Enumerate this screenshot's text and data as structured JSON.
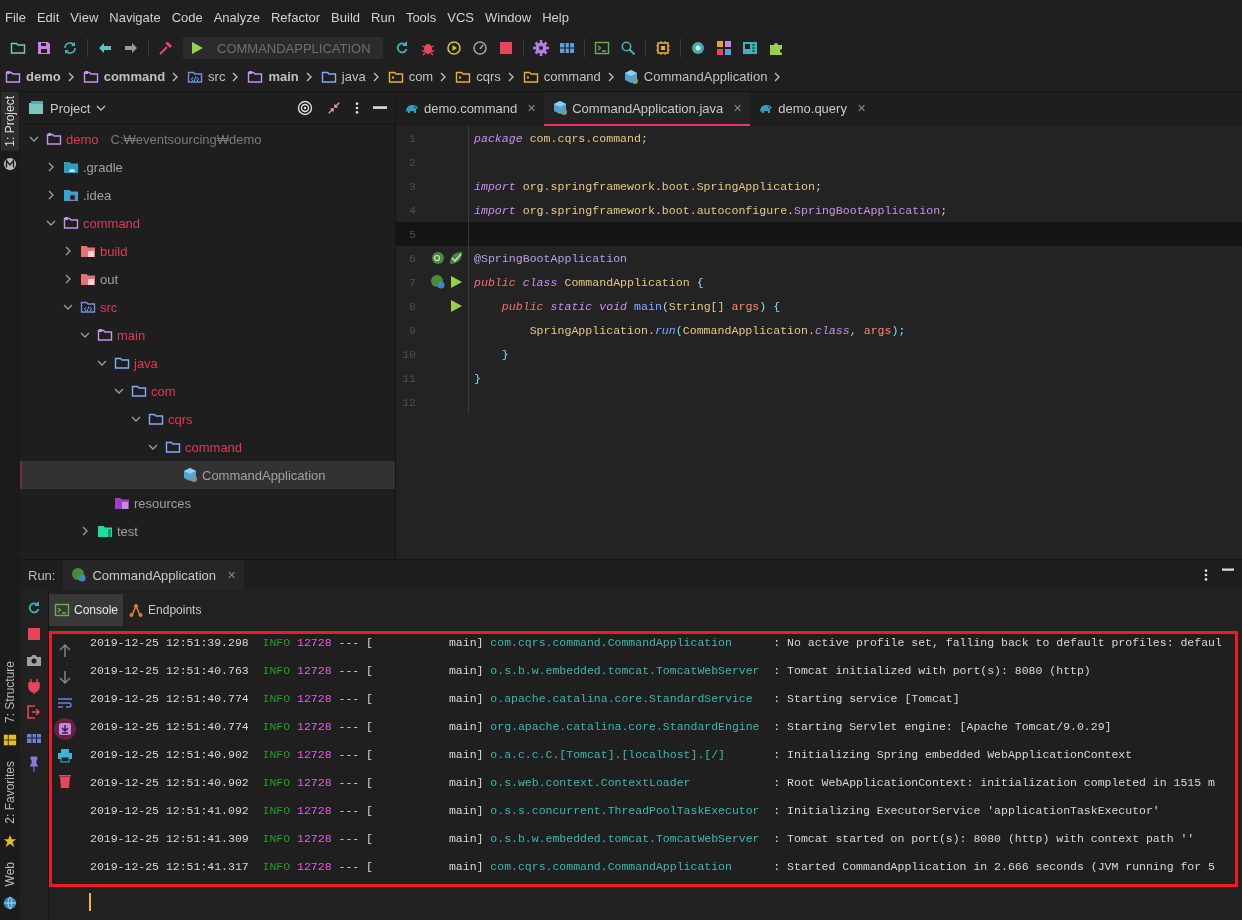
{
  "menu": [
    "File",
    "Edit",
    "View",
    "Navigate",
    "Code",
    "Analyze",
    "Refactor",
    "Build",
    "Run",
    "Tools",
    "VCS",
    "Window",
    "Help"
  ],
  "toolbar": [
    {
      "kind": "open"
    },
    {
      "kind": "save"
    },
    {
      "kind": "sync"
    },
    {
      "kind": "sep"
    },
    {
      "kind": "back"
    },
    {
      "kind": "forward"
    },
    {
      "kind": "sep"
    },
    {
      "kind": "build"
    },
    {
      "kind": "run-config",
      "label": "COMMANDAPPLICATION"
    },
    {
      "kind": "rerun"
    },
    {
      "kind": "debug"
    },
    {
      "kind": "coverage"
    },
    {
      "kind": "profile"
    },
    {
      "kind": "stop"
    },
    {
      "kind": "sep"
    },
    {
      "kind": "gear"
    },
    {
      "kind": "grid"
    },
    {
      "kind": "sep"
    },
    {
      "kind": "terminal"
    },
    {
      "kind": "search"
    },
    {
      "kind": "sep"
    },
    {
      "kind": "chip"
    },
    {
      "kind": "sep"
    },
    {
      "kind": "dot"
    },
    {
      "kind": "squares"
    },
    {
      "kind": "panel"
    },
    {
      "kind": "puzzle"
    }
  ],
  "breadcrumbs": [
    {
      "label": "demo",
      "kind": "module"
    },
    {
      "label": "command",
      "kind": "module"
    },
    {
      "label": "src",
      "kind": "source"
    },
    {
      "label": "main",
      "kind": "module"
    },
    {
      "label": "java",
      "kind": "folder"
    },
    {
      "label": "com",
      "kind": "package"
    },
    {
      "label": "cqrs",
      "kind": "package"
    },
    {
      "label": "command",
      "kind": "package"
    },
    {
      "label": "CommandApplication",
      "kind": "class"
    }
  ],
  "stripe": {
    "top": [
      {
        "label": "1: Project",
        "selected": true
      }
    ],
    "bottom": [
      {
        "label": "7: Structure",
        "selected": false
      },
      {
        "label": "2: Favorites",
        "selected": false
      },
      {
        "label": "Web",
        "selected": false
      }
    ]
  },
  "project": {
    "title": "Project",
    "tree": [
      {
        "name": "demo",
        "hint": "C:₩eventsourcing₩demo",
        "kind": "module",
        "color": "#e8335c",
        "expanded": true,
        "selected": false,
        "children": [
          {
            "name": ".gradle",
            "kind": "gradle",
            "color": "#a0a0a0",
            "expanded": false,
            "selected": false
          },
          {
            "name": ".idea",
            "kind": "idea",
            "color": "#a0a0a0",
            "expanded": false,
            "selected": false
          },
          {
            "name": "command",
            "kind": "module",
            "color": "#e8335c",
            "expanded": true,
            "selected": false,
            "children": [
              {
                "name": "build",
                "kind": "excluded",
                "color": "#e8335c",
                "expanded": false,
                "selected": false
              },
              {
                "name": "out",
                "kind": "excluded",
                "color": "#a0a0a0",
                "expanded": false,
                "selected": false
              },
              {
                "name": "src",
                "kind": "source",
                "color": "#e8335c",
                "expanded": true,
                "selected": false,
                "children": [
                  {
                    "name": "main",
                    "kind": "module",
                    "color": "#e8335c",
                    "expanded": true,
                    "selected": false,
                    "children": [
                      {
                        "name": "java",
                        "kind": "folder",
                        "color": "#e8335c",
                        "expanded": true,
                        "selected": false,
                        "children": [
                          {
                            "name": "com",
                            "kind": "folder",
                            "color": "#e8335c",
                            "expanded": true,
                            "selected": false,
                            "children": [
                              {
                                "name": "cqrs",
                                "kind": "folder",
                                "color": "#e8335c",
                                "expanded": true,
                                "selected": false,
                                "children": [
                                  {
                                    "name": "command",
                                    "kind": "folder",
                                    "color": "#e8335c",
                                    "expanded": true,
                                    "selected": false,
                                    "children": [
                                      {
                                        "name": "CommandApplication",
                                        "kind": "class",
                                        "color": "#a0a0a0",
                                        "selected": true
                                      }
                                    ]
                                  }
                                ]
                              }
                            ]
                          }
                        ]
                      },
                      {
                        "name": "resources",
                        "kind": "resources",
                        "color": "#a0a0a0",
                        "selected": false
                      }
                    ]
                  },
                  {
                    "name": "test",
                    "kind": "test",
                    "color": "#a0a0a0",
                    "expanded": false,
                    "selected": false
                  }
                ]
              }
            ]
          }
        ]
      }
    ]
  },
  "editor": {
    "tabs": [
      {
        "label": "demo.command",
        "kind": "gradle",
        "close": "✕",
        "selected": false
      },
      {
        "label": "CommandApplication.java",
        "kind": "class",
        "close": "✕",
        "selected": true
      },
      {
        "label": "demo.query",
        "kind": "gradle",
        "close": "✕",
        "selected": false
      }
    ],
    "lines": [
      {
        "number": "1",
        "current": false,
        "tokens": [
          {
            "kind": "kw",
            "t": "package"
          },
          {
            "kind": "ident",
            "t": " com.cqrs.command;"
          }
        ]
      },
      {
        "number": "2",
        "current": false
      },
      {
        "number": "3",
        "current": false,
        "tokens": [
          {
            "kind": "kw",
            "t": "import"
          },
          {
            "kind": "ident",
            "t": " org.springframework.boot.SpringApplication;"
          }
        ]
      },
      {
        "number": "4",
        "current": false,
        "tokens": [
          {
            "kind": "kw",
            "t": "import"
          },
          {
            "kind": "ident",
            "t": " org.springframework.boot.autoconfigure."
          },
          {
            "kind": "type",
            "t": "SpringBootApplication"
          },
          {
            "kind": "ident",
            "t": ";"
          }
        ]
      },
      {
        "number": "5",
        "current": true
      },
      {
        "number": "6",
        "current": false,
        "gutter": [
          {
            "kind": "bean-find"
          },
          {
            "kind": "bean-check"
          }
        ],
        "tokens": [
          {
            "kind": "annot",
            "t": "@SpringBootApplication"
          }
        ]
      },
      {
        "number": "7",
        "current": false,
        "gutter": [
          {
            "kind": "bean-run"
          },
          {
            "kind": "run"
          }
        ],
        "tokens": [
          {
            "kind": "mod",
            "t": "public"
          },
          {
            "kind": "kw",
            "t": " class"
          },
          {
            "kind": "ident",
            "t": " CommandApplication"
          },
          {
            "kind": "punct",
            "t": " {"
          }
        ]
      },
      {
        "number": "8",
        "current": false,
        "gutter": [
          {
            "kind": "run"
          }
        ],
        "tokens": [
          {
            "kind": "mod",
            "t": "    public"
          },
          {
            "kind": "kw",
            "t": " static void"
          },
          {
            "kind": "method",
            "t": " main"
          },
          {
            "kind": "punct",
            "t": "("
          },
          {
            "kind": "ident",
            "t": "String[]"
          },
          {
            "kind": "param",
            "t": " args"
          },
          {
            "kind": "punct",
            "t": ") {"
          }
        ]
      },
      {
        "number": "9",
        "current": false,
        "tokens": [
          {
            "kind": "ident",
            "t": "        SpringApplication."
          },
          {
            "kind": "call",
            "t": "run"
          },
          {
            "kind": "punct",
            "t": "("
          },
          {
            "kind": "ident",
            "t": "CommandApplication."
          },
          {
            "kind": "kw",
            "t": "class"
          },
          {
            "kind": "punct",
            "t": ", "
          },
          {
            "kind": "param",
            "t": "args"
          },
          {
            "kind": "punct",
            "t": ");"
          }
        ]
      },
      {
        "number": "10",
        "current": false,
        "tokens": [
          {
            "kind": "punct",
            "t": "    }"
          }
        ]
      },
      {
        "number": "11",
        "current": false,
        "tokens": [
          {
            "kind": "punct",
            "t": "}"
          }
        ]
      },
      {
        "number": "12",
        "current": false
      }
    ]
  },
  "run": {
    "label": "Run:",
    "tab": "CommandApplication",
    "close": "✕",
    "tools": [
      {
        "kind": "rerun"
      },
      {
        "kind": "stop"
      },
      {
        "kind": "camera"
      },
      {
        "kind": "plug"
      },
      {
        "kind": "exit"
      },
      {
        "kind": "layout"
      },
      {
        "kind": "pin"
      }
    ],
    "console_tabs": [
      {
        "label": "Console",
        "kind": "terminal",
        "selected": true
      },
      {
        "label": "Endpoints",
        "kind": "endpoints",
        "selected": false
      }
    ],
    "gutter": [
      {
        "kind": "up",
        "selected": false
      },
      {
        "kind": "down",
        "selected": false
      },
      {
        "kind": "wrap",
        "selected": false
      },
      {
        "kind": "scroll-end",
        "selected": true
      },
      {
        "kind": "print",
        "selected": false
      },
      {
        "kind": "trash",
        "selected": false
      }
    ],
    "log": [
      {
        "time": "2019-12-25 12:51:39.298",
        "level": "INFO",
        "pid": "12728",
        "sep": "---",
        "thread": "[           main]",
        "logger": "com.cqrs.command.CommandApplication",
        "message": ": No active profile set, falling back to default profiles: defaul"
      },
      {
        "time": "2019-12-25 12:51:40.763",
        "level": "INFO",
        "pid": "12728",
        "sep": "---",
        "thread": "[           main]",
        "logger": "o.s.b.w.embedded.tomcat.TomcatWebServer",
        "message": ": Tomcat initialized with port(s): 8080 (http)"
      },
      {
        "time": "2019-12-25 12:51:40.774",
        "level": "INFO",
        "pid": "12728",
        "sep": "---",
        "thread": "[           main]",
        "logger": "o.apache.catalina.core.StandardService",
        "message": ": Starting service [Tomcat]"
      },
      {
        "time": "2019-12-25 12:51:40.774",
        "level": "INFO",
        "pid": "12728",
        "sep": "---",
        "thread": "[           main]",
        "logger": "org.apache.catalina.core.StandardEngine",
        "message": ": Starting Servlet engine: [Apache Tomcat/9.0.29]"
      },
      {
        "time": "2019-12-25 12:51:40.902",
        "level": "INFO",
        "pid": "12728",
        "sep": "---",
        "thread": "[           main]",
        "logger": "o.a.c.c.C.[Tomcat].[localhost].[/]",
        "message": ": Initializing Spring embedded WebApplicationContext"
      },
      {
        "time": "2019-12-25 12:51:40.902",
        "level": "INFO",
        "pid": "12728",
        "sep": "---",
        "thread": "[           main]",
        "logger": "o.s.web.context.ContextLoader",
        "message": ": Root WebApplicationContext: initialization completed in 1515 m"
      },
      {
        "time": "2019-12-25 12:51:41.092",
        "level": "INFO",
        "pid": "12728",
        "sep": "---",
        "thread": "[           main]",
        "logger": "o.s.s.concurrent.ThreadPoolTaskExecutor",
        "message": ": Initializing ExecutorService 'applicationTaskExecutor'"
      },
      {
        "time": "2019-12-25 12:51:41.309",
        "level": "INFO",
        "pid": "12728",
        "sep": "---",
        "thread": "[           main]",
        "logger": "o.s.b.w.embedded.tomcat.TomcatWebServer",
        "message": ": Tomcat started on port(s): 8080 (http) with context path ''"
      },
      {
        "time": "2019-12-25 12:51:41.317",
        "level": "INFO",
        "pid": "12728",
        "sep": "---",
        "thread": "[           main]",
        "logger": "com.cqrs.command.CommandApplication",
        "message": ": Started CommandApplication in 2.666 seconds (JVM running for 5"
      }
    ]
  }
}
